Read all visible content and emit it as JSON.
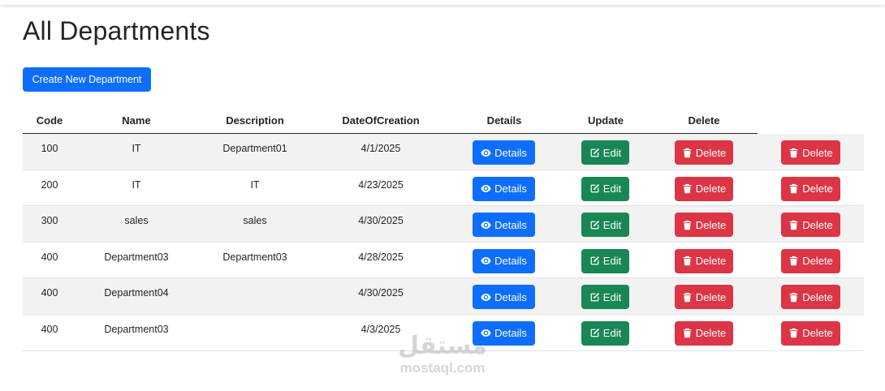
{
  "page": {
    "title": "All Departments",
    "create_label": "Create New Department"
  },
  "table": {
    "headers": {
      "code": "Code",
      "name": "Name",
      "description": "Description",
      "date": "DateOfCreation",
      "details": "Details",
      "update": "Update",
      "delete": "Delete"
    },
    "buttons": {
      "details": "Details",
      "edit": "Edit",
      "delete": "Delete"
    },
    "rows": [
      {
        "code": "100",
        "name": "IT",
        "description": "Department01",
        "date": "4/1/2025"
      },
      {
        "code": "200",
        "name": "IT",
        "description": "IT",
        "date": "4/23/2025"
      },
      {
        "code": "300",
        "name": "sales",
        "description": "sales",
        "date": "4/30/2025"
      },
      {
        "code": "400",
        "name": "Department03",
        "description": "Department03",
        "date": "4/28/2025"
      },
      {
        "code": "400",
        "name": "Department04",
        "description": "",
        "date": "4/30/2025"
      },
      {
        "code": "400",
        "name": "Department03",
        "description": "",
        "date": "4/3/2025"
      }
    ]
  },
  "watermark": {
    "arabic": "مستقل",
    "latin": "mostaql.com"
  },
  "colors": {
    "primary": "#0d6efd",
    "success": "#198754",
    "danger": "#dc3545",
    "stripe": "#f2f2f2"
  },
  "icons": {
    "details": "eye-icon",
    "edit": "pencil-square-icon",
    "delete": "trash-icon"
  }
}
